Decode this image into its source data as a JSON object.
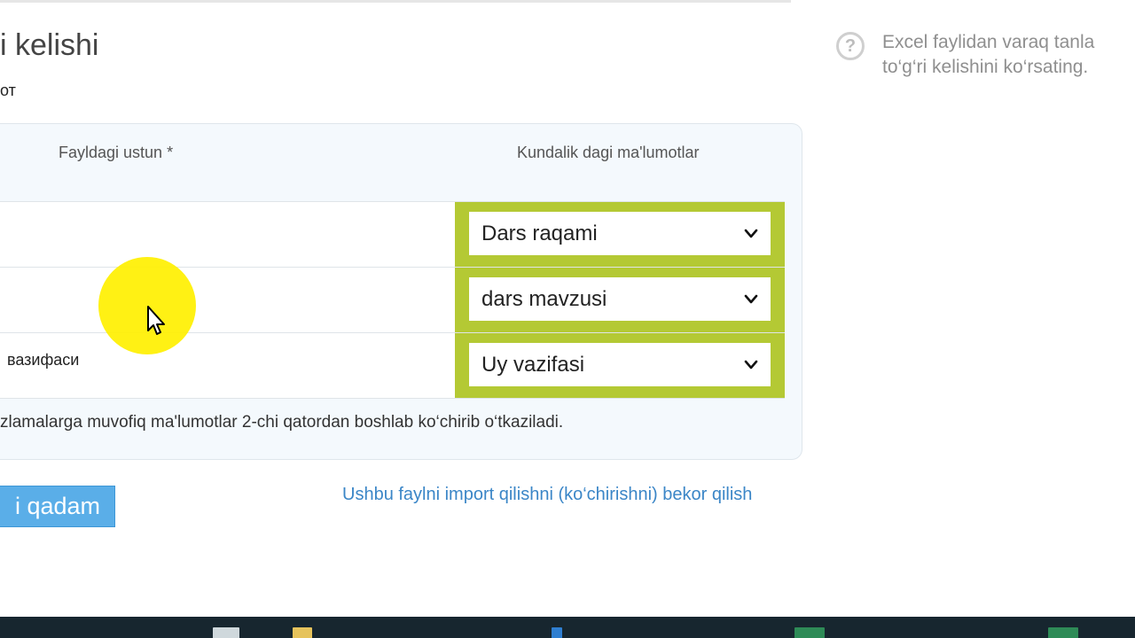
{
  "page": {
    "title_fragment": "i kelishi",
    "subline_fragment": "от"
  },
  "help": {
    "icon": "question-circle-icon",
    "text_line1": "Excel faylidan varaq tanla",
    "text_line2": "to‘g‘ri kelishini ko‘rsating."
  },
  "table": {
    "col_file": "Fayldagi ustun *",
    "col_kundalik": "Kundalik dagi ma'lumotlar",
    "rows": [
      {
        "file_column": "",
        "mapping": "Dars raqami"
      },
      {
        "file_column": "",
        "mapping": "dars mavzusi"
      },
      {
        "file_column": "вазифаси",
        "mapping": "Uy vazifasi"
      }
    ],
    "highlight_color": "#b4c934"
  },
  "note": "zlamalarga muvofiq ma'lumotlar 2-chi qatordan boshlab ko‘chirib o‘tkaziladi.",
  "actions": {
    "next_label": "i qadam",
    "cancel_label": "Ushbu faylni import qilishni (ko‘chirishni) bekor qilish"
  },
  "colors": {
    "primary_button": "#5aaee8",
    "link": "#3b86c7",
    "cursor_highlight": "#fff000"
  }
}
